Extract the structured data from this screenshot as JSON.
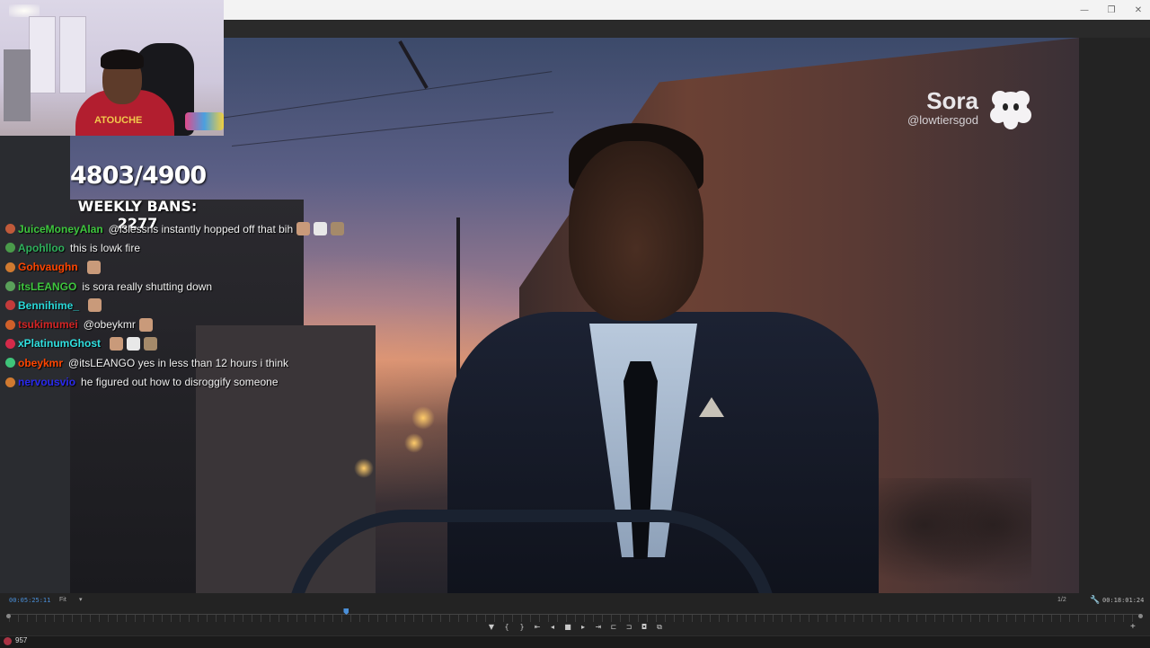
{
  "overlay": {
    "counter": "4803/4900",
    "weekly_bans": "WEEKLY BANS: 2277"
  },
  "watermark": {
    "title": "Sora",
    "handle": "@lowtiersgod"
  },
  "webcam": {
    "shirt_text": "ATOUCHE"
  },
  "chat": [
    {
      "user": "JuiceMoneyAlan",
      "color": "#3ec63e",
      "badge": "#c05a3a",
      "message": "@l3lessns instantly hopped off that bih",
      "emotes": 3
    },
    {
      "user": "Apohlloo",
      "color": "#2fb15c",
      "badge": "#4a9a4a",
      "message": "this is lowk fire",
      "emotes": 0
    },
    {
      "user": "Gohvaughn",
      "color": "#ff4500",
      "badge": "#d07a30",
      "message": "",
      "emotes": 1
    },
    {
      "user": "itsLEANGO",
      "color": "#3ec63e",
      "badge": "#5aa05a",
      "message": "is sora really shutting down",
      "emotes": 0
    },
    {
      "user": "Bennihime_",
      "color": "#29d9d9",
      "badge": "#c43b3b",
      "message": "",
      "emotes": 1
    },
    {
      "user": "tsukimumei",
      "color": "#d42424",
      "badge": "#d0602a",
      "message": "@obeykmr",
      "emotes": 1
    },
    {
      "user": "xPlatinumGhost",
      "color": "#2fe0e0",
      "badge": "#d42a4a",
      "message": "",
      "emotes": 3
    },
    {
      "user": "obeykmr",
      "color": "#ff4500",
      "badge": "#3fc47a",
      "message": "@itsLEANGO yes in less than 12 hours i think",
      "emotes": 0
    },
    {
      "user": "nervousvio",
      "color": "#2a2af0",
      "badge": "#d07a30",
      "message": "he figured out how to disroggify someone",
      "emotes": 0
    }
  ],
  "timeline": {
    "current_time": "00:05:25:11",
    "fit_label": "Fit",
    "resolution": "1/2",
    "duration": "00:18:01:24",
    "playhead_fraction": 0.298
  },
  "transport_icons": [
    "marker-icon",
    "in-point-icon",
    "out-point-icon",
    "go-to-in-icon",
    "step-back-icon",
    "stop-icon",
    "step-forward-icon",
    "go-to-out-icon",
    "insert-icon",
    "overwrite-icon",
    "export-frame-icon",
    "compare-icon"
  ],
  "status": {
    "viewer_count": "957"
  },
  "colors": {
    "timecode_blue": "#4a8fd8",
    "panel": "#232323"
  }
}
